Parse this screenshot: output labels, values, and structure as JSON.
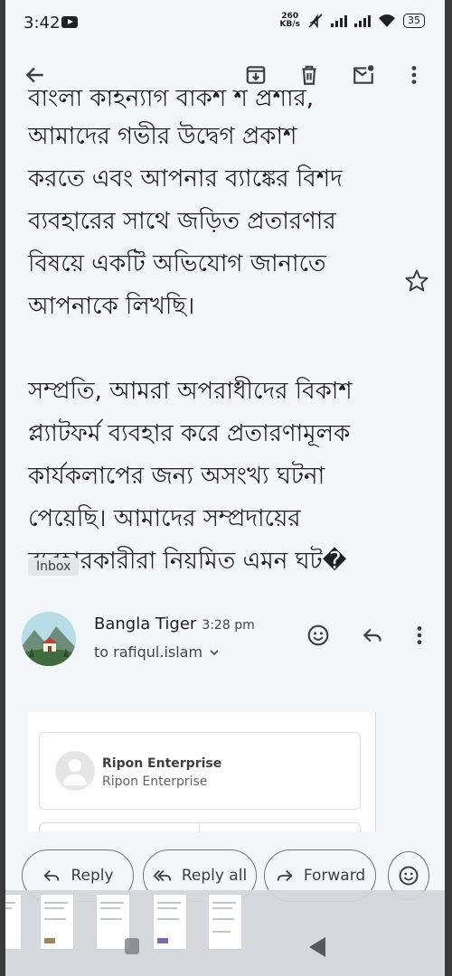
{
  "status_bar": {
    "time": "3:42",
    "speed_value": "260",
    "speed_unit": "KB/s",
    "battery": "35"
  },
  "toolbar": {
    "back_icon": "arrow-left-icon",
    "archive_icon": "archive-icon",
    "delete_icon": "trash-icon",
    "mark_unread_icon": "mail-unread-icon",
    "more_icon": "more-vert-icon"
  },
  "email": {
    "body_partial_top": "বাংলা কাহন্যাগ বাকশ শ প্রশার,",
    "paragraph1_lines": [
      "আমাদের গভীর উদ্বেগ প্রকাশ",
      "করতে এবং আপনার ব্যাঙ্কের বিশদ",
      "ব্যবহারের সাথে জড়িত প্রতারণার",
      "বিষয়ে একটি অভিযোগ জানাতে",
      "আপনাকে লিখছি।"
    ],
    "paragraph2_lines": [
      "সম্প্রতি, আমরা অপরাধীদের বিকাশ",
      "প্ল্যাটফর্ম ব্যবহার করে প্রতারণামূলক",
      "কার্যকলাপের জন্য অসংখ্য ঘটনা",
      "পেয়েছি। আমাদের সম্প্রদায়ের",
      "ব্যবহারকারীরা নিয়মিত এমন ঘট�"
    ],
    "label": "Inbox"
  },
  "message": {
    "sender": "Bangla Tiger",
    "time": "3:28 pm",
    "to": "to rafiqul.islam",
    "embed_title": "Ripon Enterprise",
    "embed_subtitle": "Ripon Enterprise"
  },
  "actions": {
    "reply": "Reply",
    "reply_all": "Reply all",
    "forward": "Forward"
  },
  "colors": {
    "background": "#f3f7fa",
    "text": "#1f1f1f",
    "icon": "#3c4043"
  }
}
